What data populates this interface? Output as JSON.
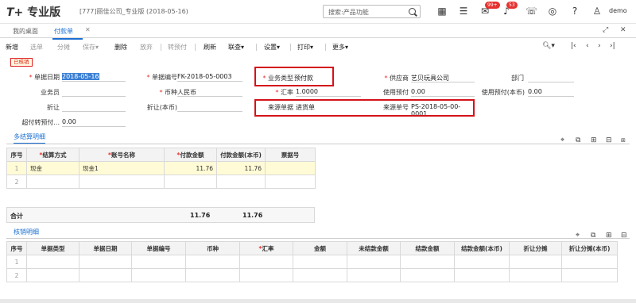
{
  "topbar": {
    "logo": "T+",
    "product": "专业版",
    "company": "[777]丽佳公司_专业版 (2018-05-16)",
    "search_placeholder": "搜索:产品功能",
    "badge1": "99+",
    "badge2": "53",
    "user": "demo"
  },
  "tabs": [
    {
      "label": "我的桌面"
    },
    {
      "label": "付款单"
    }
  ],
  "toolbar": {
    "items": [
      "新增",
      "选单",
      "分摊",
      "保存▾",
      "删除",
      "放弃",
      "转预付",
      "刷新",
      "联查▾",
      "设置▾",
      "打印▾",
      "更多▾"
    ]
  },
  "status_tag": "已核销",
  "form": {
    "doc_date": {
      "label": "单据日期",
      "value": "2018-05-16"
    },
    "doc_no": {
      "label": "单据编号",
      "value": "FK-2018-05-0003"
    },
    "biz_type": {
      "label": "业务类型",
      "value": "预付款"
    },
    "supplier": {
      "label": "供应商",
      "value": "艺贝玩具公司"
    },
    "dept": {
      "label": "部门",
      "value": ""
    },
    "salesman": {
      "label": "业务员",
      "value": ""
    },
    "currency": {
      "label": "币种",
      "value": "人民币"
    },
    "rate": {
      "label": "汇率",
      "value": "1.0000"
    },
    "use_prepay": {
      "label": "使用预付",
      "value": "0.00"
    },
    "use_prepay_base": {
      "label": "使用预付(本币)",
      "value": "0.00"
    },
    "discount": {
      "label": "折让",
      "value": ""
    },
    "discount_base": {
      "label": "折让(本币)",
      "value": ""
    },
    "src_type": {
      "label": "来源单据",
      "value": "进货单"
    },
    "src_no": {
      "label": "来源单号",
      "value": "PS-2018-05-00-0001"
    },
    "over_prepay": {
      "label": "超付转预付...",
      "value": "0.00"
    }
  },
  "settle": {
    "title": "多结算明细",
    "headers": [
      "序号",
      "结算方式",
      "账号名称",
      "付款金额",
      "付款金额(本币)",
      "票据号"
    ],
    "rows": [
      [
        "1",
        "现金",
        "现金1",
        "11.76",
        "11.76",
        ""
      ],
      [
        "2",
        "",
        "",
        "",
        "",
        ""
      ]
    ],
    "sum_label": "合计",
    "sum_amount": "11.76",
    "sum_amount_base": "11.76"
  },
  "writeoff": {
    "title": "核销明细",
    "headers": [
      "序号",
      "单据类型",
      "单据日期",
      "单据编号",
      "币种",
      "汇率",
      "金额",
      "未结款金额",
      "结款金额",
      "结款金额(本币)",
      "折让分摊",
      "折让分摊(本币)"
    ],
    "rows": [
      [
        "1",
        "",
        "",
        "",
        "",
        "",
        "",
        "",
        "",
        "",
        "",
        ""
      ],
      [
        "2",
        "",
        "",
        "",
        "",
        "",
        "",
        "",
        "",
        "",
        "",
        ""
      ]
    ]
  }
}
